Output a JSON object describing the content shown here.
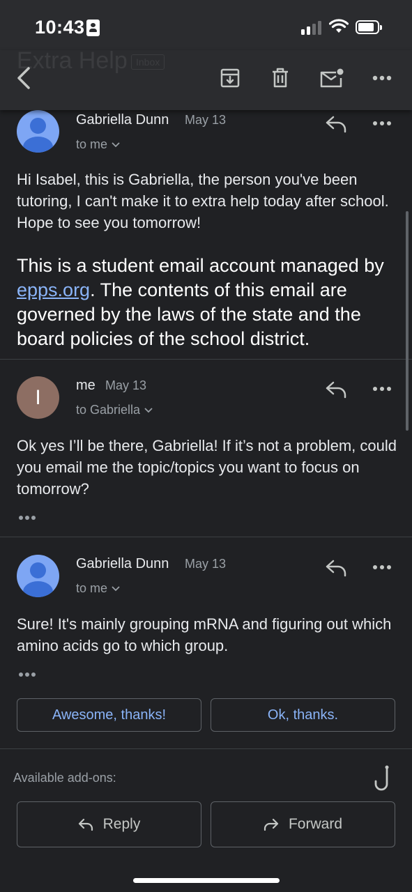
{
  "status_bar": {
    "time": "10:43"
  },
  "toolbar": {
    "ghost_title": "Extra Help",
    "ghost_badge": "Inbox"
  },
  "messages": [
    {
      "sender": "Gabriella Dunn",
      "date": "May 13",
      "recipient": "to me",
      "body": "Hi Isabel, this is Gabriella, the person you've been tutoring, I can't make it to extra help today after school. Hope to see you tomorrow!",
      "footer_before": "This is a student email account managed by ",
      "footer_link": "epps.org",
      "footer_after": ". The contents of this email are governed by the laws of the state and the board policies of the school district."
    },
    {
      "sender": "me",
      "avatar_letter": "I",
      "date": "May 13",
      "recipient": "to Gabriella",
      "body": "Ok yes I’ll be there, Gabriella! If it’s not a problem, could you email me the topic/topics you want to focus on tomorrow?"
    },
    {
      "sender": "Gabriella Dunn",
      "date": "May 13",
      "recipient": "to me",
      "body": "Sure! It's mainly grouping mRNA and figuring out which amino acids go to which group."
    }
  ],
  "smart_replies": [
    "Awesome, thanks!",
    "Ok, thanks."
  ],
  "addons": {
    "label": "Available add-ons:"
  },
  "actions": {
    "reply": "Reply",
    "forward": "Forward"
  },
  "colors": {
    "background": "#202124",
    "link": "#8ab4f8",
    "avatar_blue": "#7ea6f4",
    "avatar_brown": "#8d6e63"
  }
}
